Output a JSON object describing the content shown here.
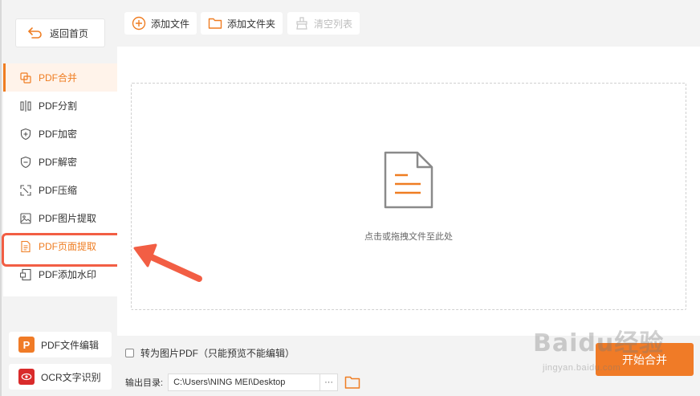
{
  "sidebar": {
    "back_label": "返回首页",
    "items": [
      {
        "label": "PDF合并",
        "icon": "merge-icon"
      },
      {
        "label": "PDF分割",
        "icon": "split-icon"
      },
      {
        "label": "PDF加密",
        "icon": "shield-plus-icon"
      },
      {
        "label": "PDF解密",
        "icon": "shield-minus-icon"
      },
      {
        "label": "PDF压缩",
        "icon": "compress-icon"
      },
      {
        "label": "PDF图片提取",
        "icon": "image-icon"
      },
      {
        "label": "PDF页面提取",
        "icon": "page-icon"
      },
      {
        "label": "PDF添加水印",
        "icon": "watermark-icon"
      }
    ],
    "pdf_editor_label": "PDF文件编辑",
    "ocr_label": "OCR文字识别"
  },
  "toolbar": {
    "add_file_label": "添加文件",
    "add_folder_label": "添加文件夹",
    "clear_list_label": "清空列表"
  },
  "content": {
    "drop_hint": "点击或拖拽文件至此处"
  },
  "footer": {
    "convert_label": "转为图片PDF（只能预览不能编辑）",
    "output_label": "输出目录:",
    "output_path": "C:\\Users\\NING MEI\\Desktop",
    "browse_label": "···",
    "start_label": "开始合并"
  },
  "watermark": {
    "brand": "Baidu经验",
    "url": "jingyan.baidu.com"
  },
  "colors": {
    "accent": "#ef7d22",
    "highlight_border": "#f25e44",
    "start_button": "#f07b27"
  }
}
